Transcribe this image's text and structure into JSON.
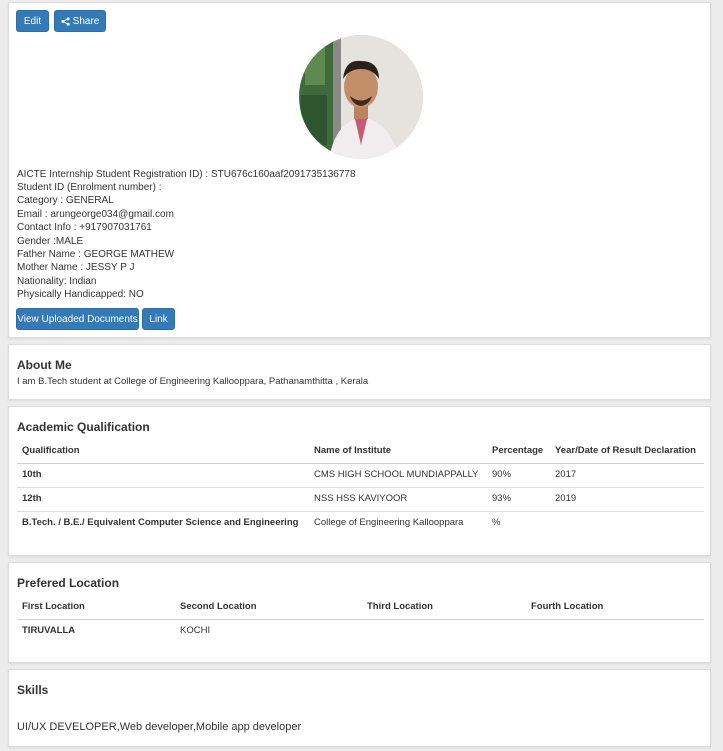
{
  "toolbar": {
    "edit_label": "Edit",
    "share_label": "Share"
  },
  "profile": {
    "lines": [
      "AICTE Internship Student Registration ID) : STU676c160aaf2091735136778",
      "Student ID (Enrolment number) :",
      "Category : GENERAL",
      "Email : arungeorge034@gmail.com",
      "Contact Info : +917907031761",
      "Gender :MALE",
      "Father Name : GEORGE MATHEW",
      "Mother Name : JESSY P J",
      "Nationality: Indian",
      "Physically Handicapped: NO"
    ],
    "view_docs_label": "View Uploaded Documents",
    "link_label": "Link"
  },
  "about": {
    "title": "About Me",
    "text": "I am B.Tech student at College of Engineering Kallooppara, Pathanamthitta , Kerala"
  },
  "academic": {
    "title": "Academic Qualification",
    "headers": [
      "Qualification",
      "Name of Institute",
      "Percentage",
      "Year/Date of Result Declaration"
    ],
    "rows": [
      [
        "10th",
        "CMS HIGH SCHOOL MUNDIAPPALLY",
        "90%",
        "2017"
      ],
      [
        "12th",
        "NSS HSS KAVIYOOR",
        "93%",
        "2019"
      ],
      [
        "B.Tech. / B.E./ Equivalent Computer Science and Engineering",
        "College of Engineering Kallooppara",
        "%",
        ""
      ]
    ]
  },
  "location": {
    "title": "Prefered Location",
    "headers": [
      "First Location",
      "Second Location",
      "Third Location",
      "Fourth Location"
    ],
    "values": [
      "TIRUVALLA",
      "KOCHI",
      "",
      ""
    ]
  },
  "skills": {
    "title": "Skills",
    "text": "UI/UX DEVELOPER,Web developer,Mobile app developer"
  },
  "colors": {
    "button": "#337ab7",
    "background": "#ececec"
  }
}
